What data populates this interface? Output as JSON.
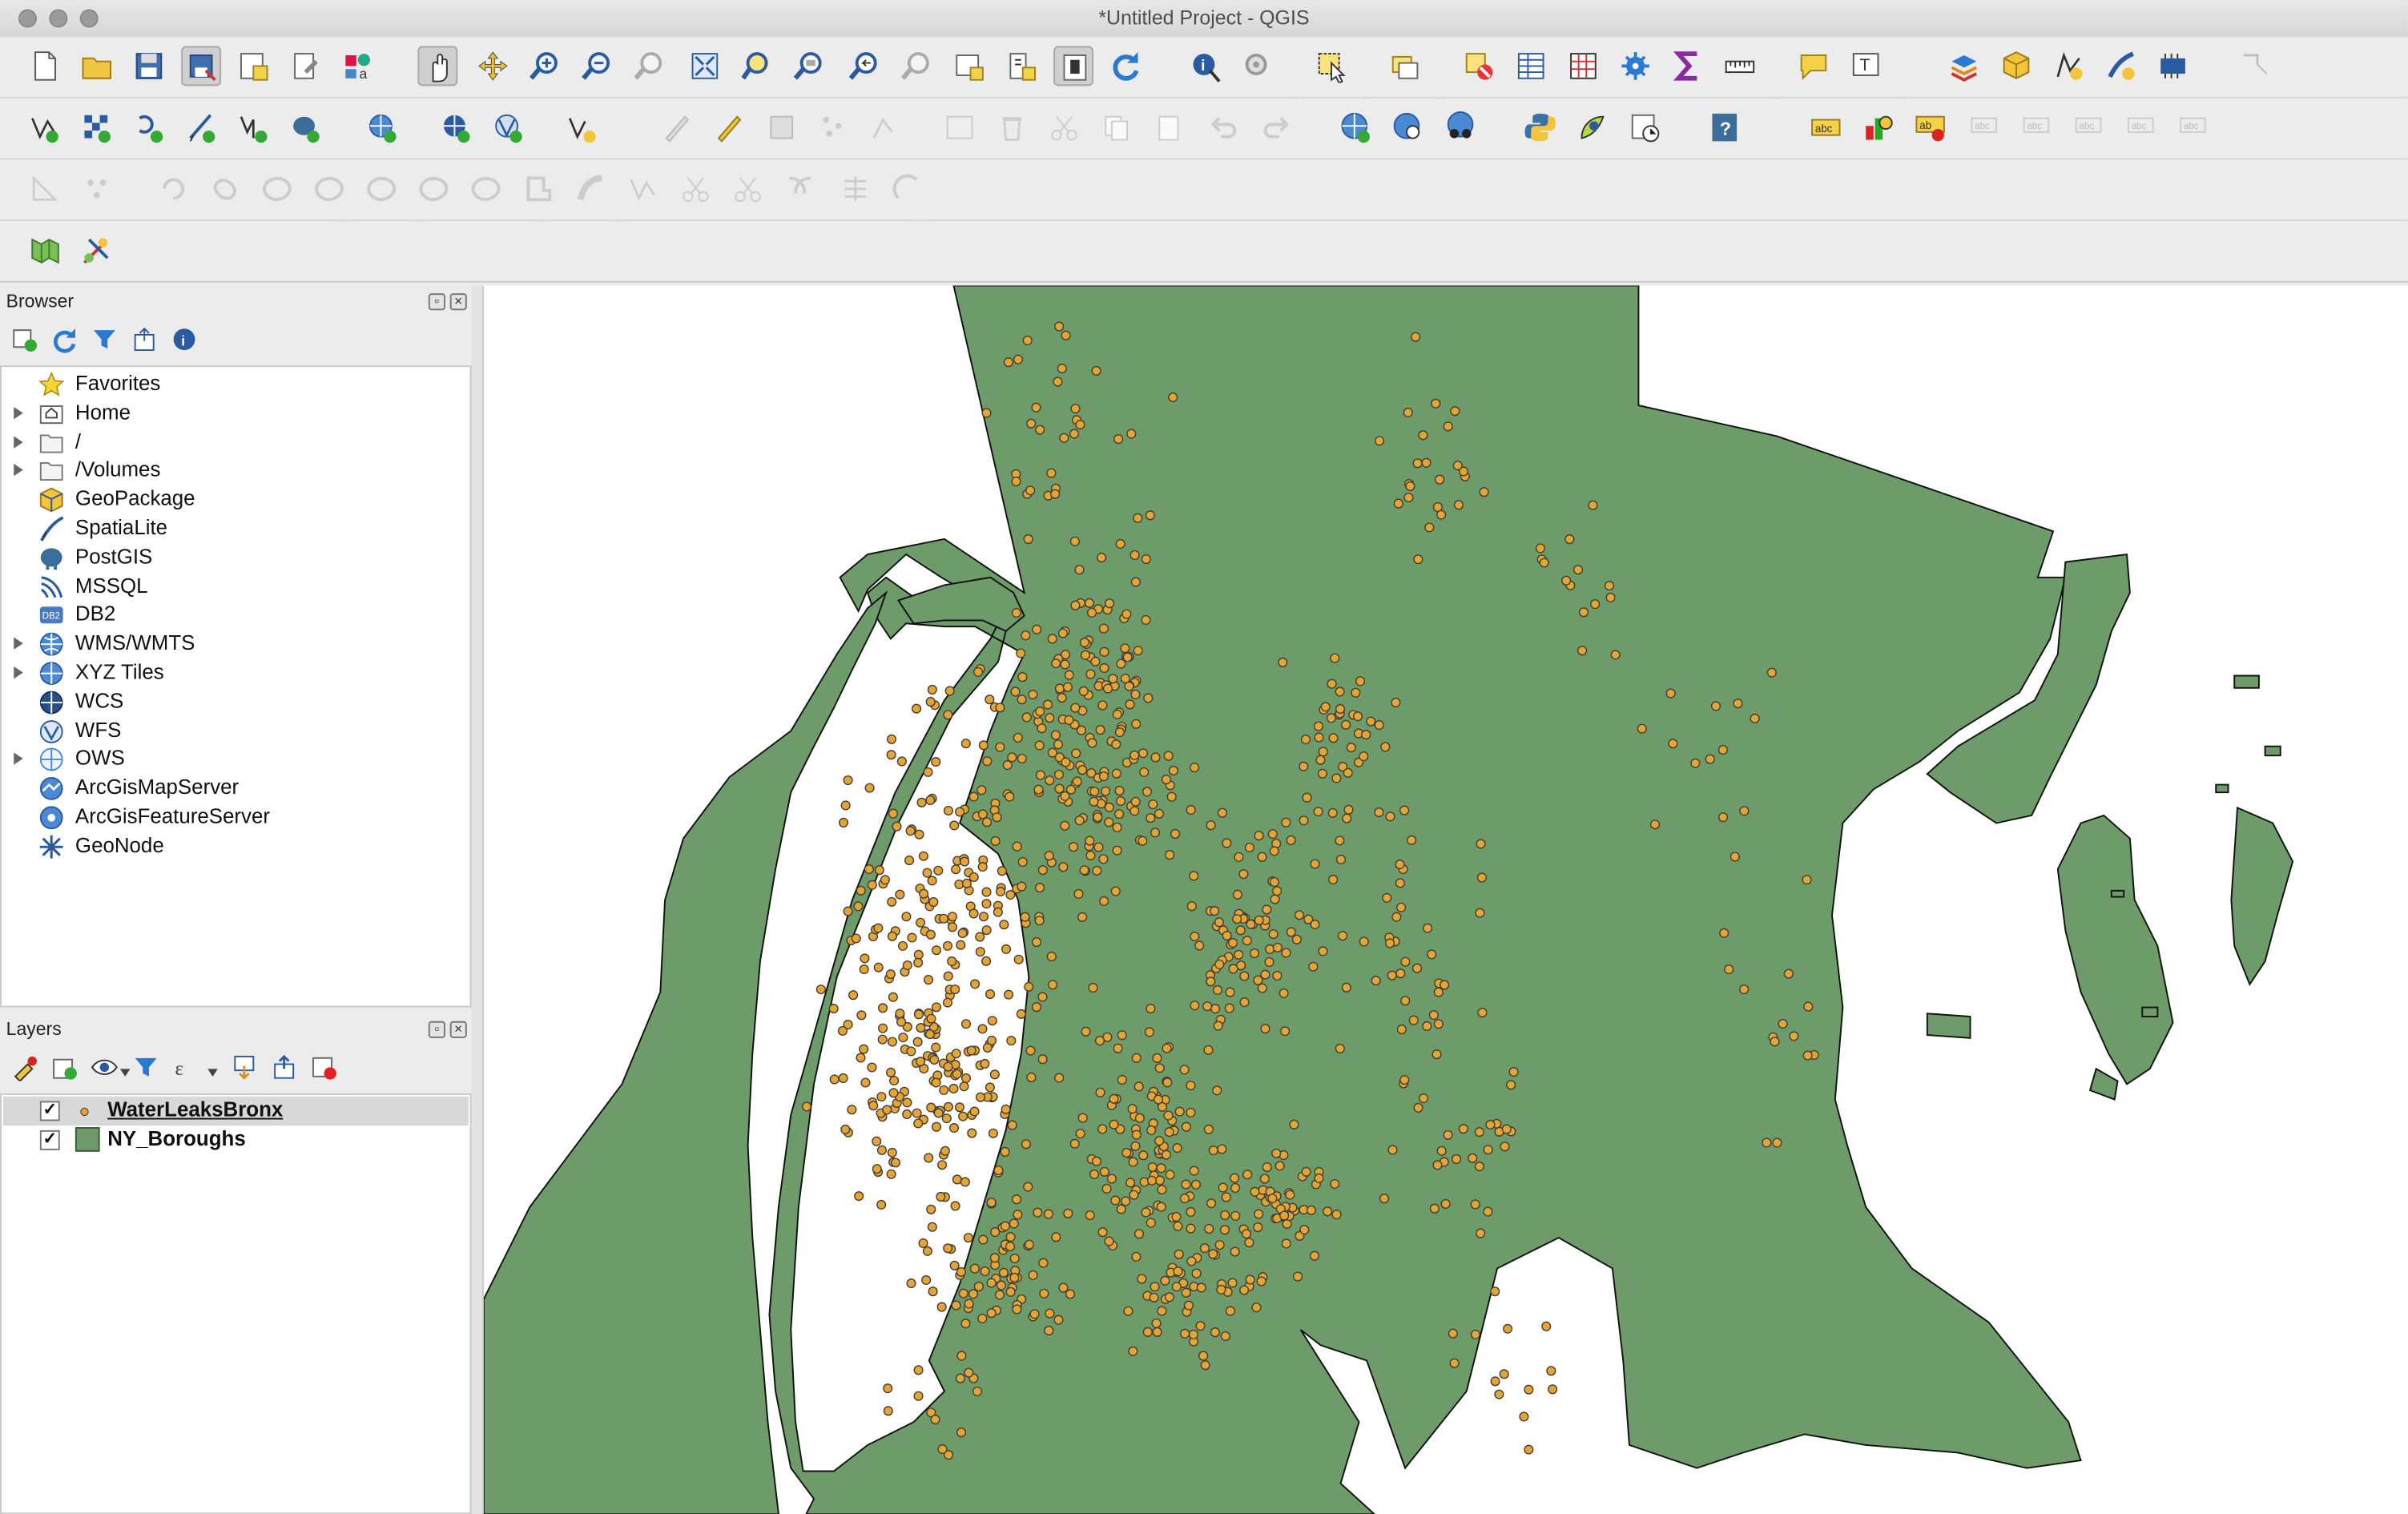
{
  "window": {
    "title": "*Untitled Project - QGIS"
  },
  "browser_panel": {
    "title": "Browser",
    "items": [
      {
        "label": "Favorites",
        "icon": "star-icon",
        "expandable": false
      },
      {
        "label": "Home",
        "icon": "home-folder-icon",
        "expandable": true
      },
      {
        "label": "/",
        "icon": "folder-icon",
        "expandable": true
      },
      {
        "label": "/Volumes",
        "icon": "folder-icon",
        "expandable": true
      },
      {
        "label": "GeoPackage",
        "icon": "geopackage-icon",
        "expandable": false
      },
      {
        "label": "SpatiaLite",
        "icon": "spatialite-icon",
        "expandable": false
      },
      {
        "label": "PostGIS",
        "icon": "postgis-elephant-icon",
        "expandable": false
      },
      {
        "label": "MSSQL",
        "icon": "mssql-icon",
        "expandable": false
      },
      {
        "label": "DB2",
        "icon": "db2-icon",
        "expandable": false
      },
      {
        "label": "WMS/WMTS",
        "icon": "wms-globe-icon",
        "expandable": true
      },
      {
        "label": "XYZ Tiles",
        "icon": "xyz-globe-icon",
        "expandable": true
      },
      {
        "label": "WCS",
        "icon": "wcs-globe-icon",
        "expandable": false
      },
      {
        "label": "WFS",
        "icon": "wfs-globe-icon",
        "expandable": false
      },
      {
        "label": "OWS",
        "icon": "ows-globe-icon",
        "expandable": true
      },
      {
        "label": "ArcGisMapServer",
        "icon": "arcgis-map-icon",
        "expandable": false
      },
      {
        "label": "ArcGisFeatureServer",
        "icon": "arcgis-feature-icon",
        "expandable": false
      },
      {
        "label": "GeoNode",
        "icon": "geonode-icon",
        "expandable": false
      }
    ]
  },
  "layers_panel": {
    "title": "Layers",
    "layers": [
      {
        "name": "WaterLeaksBronx",
        "checked": true,
        "selected": true,
        "symbol": "point-icon"
      },
      {
        "name": "NY_Boroughs",
        "checked": true,
        "selected": false,
        "symbol": "polygon-fill-icon"
      }
    ]
  },
  "colors": {
    "borough_fill": "#6d9b69",
    "point_fill": "#e6a532",
    "accent_blue": "#3d7bd4",
    "toolbar_bg": "#ececec"
  },
  "map": {
    "layers_shown": [
      "NY_Boroughs polygon (Bronx)",
      "WaterLeaksBronx points"
    ],
    "points_estimated_count": 1100
  }
}
